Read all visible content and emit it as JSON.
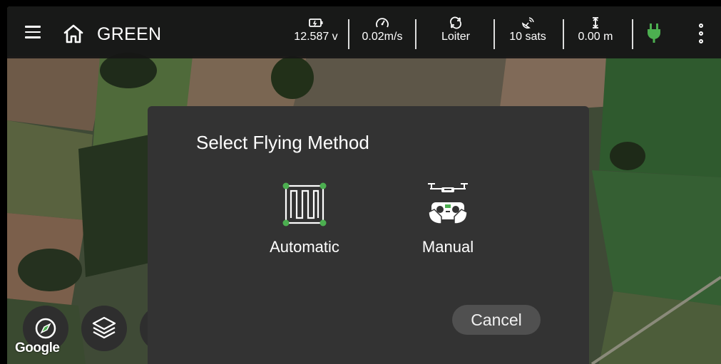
{
  "app": {
    "title": "GREEN"
  },
  "status": {
    "voltage": "12.587 v",
    "speed": "0.02m/s",
    "mode": "Loiter",
    "sats": "10 sats",
    "altitude": "0.00 m"
  },
  "dialog": {
    "title": "Select Flying Method",
    "options": [
      {
        "label": "Automatic",
        "icon": "grid-pattern-icon"
      },
      {
        "label": "Manual",
        "icon": "drone-remote-icon"
      }
    ],
    "cancel_label": "Cancel"
  },
  "map": {
    "attribution": "Google"
  },
  "colors": {
    "accent": "#4caf50",
    "dialog_bg": "#333333",
    "topbar_bg": "#161616"
  }
}
